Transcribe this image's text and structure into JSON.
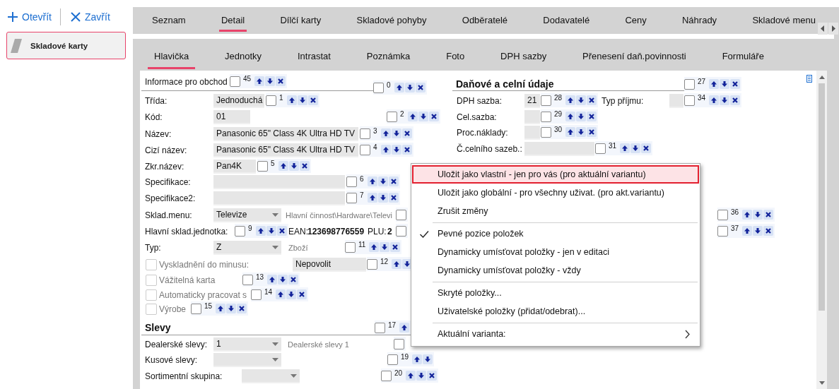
{
  "toolbar": {
    "open": "Otevřít",
    "close": "Zavřít"
  },
  "sidebar": {
    "items": [
      {
        "label": "Skladové karty",
        "selected": true
      }
    ]
  },
  "main_tabs": [
    {
      "label": "Seznam",
      "selected": false
    },
    {
      "label": "Detail",
      "selected": true
    },
    {
      "label": "Dílčí karty",
      "selected": false
    },
    {
      "label": "Skladové pohyby",
      "selected": false
    },
    {
      "label": "Odběratelé",
      "selected": false
    },
    {
      "label": "Dodavatelé",
      "selected": false
    },
    {
      "label": "Ceny",
      "selected": false
    },
    {
      "label": "Náhrady",
      "selected": false
    },
    {
      "label": "Skladové menu",
      "selected": false
    }
  ],
  "sub_tabs": [
    {
      "label": "Hlavička",
      "selected": true
    },
    {
      "label": "Jednotky",
      "selected": false
    },
    {
      "label": "Intrastat",
      "selected": false
    },
    {
      "label": "Poznámka",
      "selected": false
    },
    {
      "label": "Foto",
      "selected": false
    },
    {
      "label": "DPH sazby",
      "selected": false
    },
    {
      "label": "Přenesení daň.povinnosti",
      "selected": false
    },
    {
      "label": "Formuláře",
      "selected": false
    }
  ],
  "form": {
    "left": [
      {
        "kind": "header",
        "label": "Informace pro obchod",
        "ctrl": {
          "number": "45",
          "checked": false
        },
        "ctrl2": {
          "number": "0",
          "checked": false
        }
      },
      {
        "kind": "field",
        "label": "Třída:",
        "value": "Jednoduchá",
        "ctrl": {
          "number": "1",
          "checked": false
        }
      },
      {
        "kind": "field",
        "label": "Kód:",
        "value": "01",
        "ctrl": {
          "number": "2",
          "checked": false
        }
      },
      {
        "kind": "field",
        "label": "Název:",
        "value": "Panasonic 65\" Class 4K Ultra HD TV",
        "ctrl": {
          "number": "3",
          "checked": false
        }
      },
      {
        "kind": "field",
        "label": "Cizí název:",
        "value": "Panasonic 65\" Class 4K Ultra HD TV",
        "ctrl": {
          "number": "4",
          "checked": false
        }
      },
      {
        "kind": "field",
        "label": "Zkr.název:",
        "value": "Pan4K",
        "ctrl": {
          "number": "5",
          "checked": false
        }
      },
      {
        "kind": "field",
        "label": "Specifikace:",
        "ctrl": {
          "number": "6",
          "checked": false
        }
      },
      {
        "kind": "field",
        "label": "Specifikace2:",
        "ctrl": {
          "number": "7",
          "checked": false
        }
      },
      {
        "kind": "field",
        "label": "Sklad.menu:",
        "value": "Televize",
        "dropdown": true,
        "note": "Hlavní činnost\\Hardware\\Televi",
        "ctrl": {
          "checked": false
        }
      },
      {
        "kind": "codes",
        "label": "Hlavní sklad.jednotka:",
        "ctrl": {
          "number": "9",
          "checked": false
        },
        "pairs": [
          {
            "label": "EAN:",
            "value": "123698776559"
          },
          {
            "label": "PLU:",
            "value": "2"
          }
        ],
        "ctrl2": {
          "checked": false
        }
      },
      {
        "kind": "field",
        "label": "Typ:",
        "value": "Z",
        "dropdown": true,
        "note": "Zboží",
        "ctrl": {
          "number": "11",
          "checked": false
        }
      },
      {
        "kind": "check",
        "label": "Vyskladnění do minusu:",
        "checked": false,
        "disabled": true,
        "value": "Nepovolit",
        "ctrl": {
          "number": "12",
          "checked": false
        }
      },
      {
        "kind": "check",
        "label": "Vážitelná karta",
        "checked": false,
        "disabled": true,
        "ctrl": {
          "number": "13",
          "checked": false
        }
      },
      {
        "kind": "check",
        "label": "Automaticky pracovat s",
        "checked": false,
        "disabled": true,
        "ctrl": {
          "number": "14",
          "checked": false
        }
      },
      {
        "kind": "check",
        "label": "Výrobe",
        "checked": false,
        "disabled": true,
        "ctrl": {
          "number": "15",
          "checked": false
        }
      },
      {
        "kind": "section",
        "label": "Slevy",
        "ctrl": {
          "number": "17",
          "checked": false
        }
      },
      {
        "kind": "field",
        "label": "Dealerské slevy:",
        "value": "1",
        "dropdown": true,
        "note": "Dealerské slevy 1",
        "ctrl": {
          "checked": false
        }
      },
      {
        "kind": "field",
        "label": "Kusové slevy:",
        "dropdown": true,
        "ctrl": {
          "number": "19",
          "checked": false
        }
      },
      {
        "kind": "field",
        "label": "Sortimentní skupina:",
        "dropdown": true,
        "ctrl": {
          "number": "20",
          "checked": false
        }
      }
    ],
    "right": [
      {
        "kind": "section",
        "label": "Daňové a celní údaje",
        "ctrl": {
          "number": "27",
          "checked": false
        }
      },
      {
        "kind": "field",
        "label": "DPH sazba:",
        "value": "21",
        "ctrl": {
          "number": "28",
          "checked": false
        }
      },
      {
        "kind": "field",
        "label": "Typ příjmu:",
        "ctrl": {
          "number": "34",
          "checked": false
        }
      },
      {
        "kind": "field",
        "label": "Cel.sazba:",
        "ctrl": {
          "number": "29",
          "checked": false
        }
      },
      {
        "kind": "field",
        "label": "Proc.náklady:",
        "ctrl": {
          "number": "30",
          "checked": false
        }
      },
      {
        "kind": "field",
        "label": "Č.celního sazeb.:",
        "ctrl": {
          "number": "31",
          "checked": false
        }
      },
      {
        "kind": "ctrl",
        "ctrl": {
          "number": "36",
          "checked": false
        }
      },
      {
        "kind": "ctrl",
        "ctrl": {
          "number": "37",
          "checked": false
        }
      }
    ]
  },
  "context_menu": [
    {
      "kind": "item",
      "label": "Uložit jako vlastní - jen pro vás (pro aktuální variantu)",
      "selected": true
    },
    {
      "kind": "item",
      "label": "Uložit jako globální - pro všechny uživat. (pro akt.variantu)",
      "selected": false
    },
    {
      "kind": "item",
      "label": "Zrušit změny",
      "selected": false
    },
    {
      "kind": "separator"
    },
    {
      "kind": "item",
      "label": "Pevné pozice položek",
      "checked": true,
      "selected": false
    },
    {
      "kind": "item",
      "label": "Dynamicky umísťovat položky - jen v editaci",
      "selected": false
    },
    {
      "kind": "item",
      "label": "Dynamicky umísťovat položky - vždy",
      "selected": false
    },
    {
      "kind": "separator"
    },
    {
      "kind": "item",
      "label": "Skryté položky...",
      "selected": false
    },
    {
      "kind": "item",
      "label": "Uživatelské položky (přidat/odebrat)...",
      "selected": false
    },
    {
      "kind": "separator"
    },
    {
      "kind": "item",
      "label": "Aktuální varianta:",
      "selected": false,
      "submenu": true
    }
  ]
}
